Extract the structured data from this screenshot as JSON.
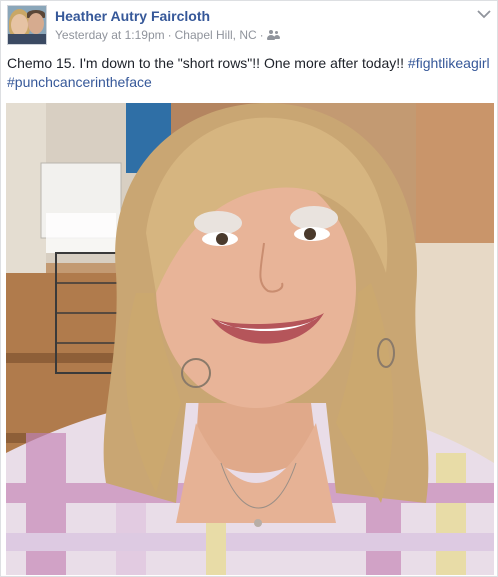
{
  "post": {
    "author": "Heather Autry Faircloth",
    "timestamp": "Yesterday at 1:19pm",
    "location": "Chapel Hill, NC",
    "separator": "·",
    "audience_icon": "friends-icon",
    "text_main": "Chemo 15. I'm down to the \"short rows\"!! One more after today!! ",
    "hashtags": [
      "#fightlikeagirl",
      "#punchcancerintheface"
    ],
    "photo_subject": "selfie-photo"
  },
  "colors": {
    "link": "#365899",
    "meta": "#90949c",
    "text": "#1d2129"
  }
}
